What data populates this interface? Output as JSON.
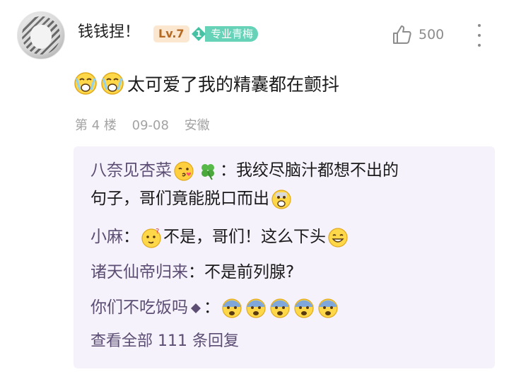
{
  "post": {
    "username": "钱钱捏！",
    "level_badge": "Lv.7",
    "fan_badge": {
      "level": "1",
      "label": "专业青梅"
    },
    "likes": "500",
    "content_text": "太可爱了我的精囊都在颤抖",
    "meta": {
      "floor": "第 4 楼",
      "date": "09-08",
      "location": "安徽"
    }
  },
  "replies": [
    {
      "author": "八奈见杏菜",
      "colon": "：",
      "line1": "我绞尽脑汁都想不出的",
      "line2": "句子，哥们竟能脱口而出"
    },
    {
      "author": "小麻",
      "colon": "：",
      "text": "不是，哥们！这么下头"
    },
    {
      "author": "诸天仙帝归来",
      "colon": "：",
      "text": "不是前列腺?"
    },
    {
      "author": "你们不吃饭吗",
      "colon": "："
    }
  ],
  "view_all": "查看全部 111 条回复",
  "icons": {
    "like": "thumb-up-icon",
    "more": "more-vertical-icon",
    "content_emoji": "crying-face-icon",
    "clover": "four-leaf-clover-icon",
    "kiss": "kissing-face-icon",
    "shocked": "shocked-face-icon",
    "thinking": "confused-face-icon",
    "smile": "grinning-face-icon",
    "fear": "fearful-face-icon",
    "diamond": "diamond-icon"
  },
  "colors": {
    "level_badge_bg": "#fbe6cf",
    "level_badge_text": "#b56a23",
    "fan_badge": "#66d3b9",
    "reply_name": "#5b4d73",
    "reply_bg": "#f6f2fb",
    "meta_gray": "#a3a3a3"
  }
}
